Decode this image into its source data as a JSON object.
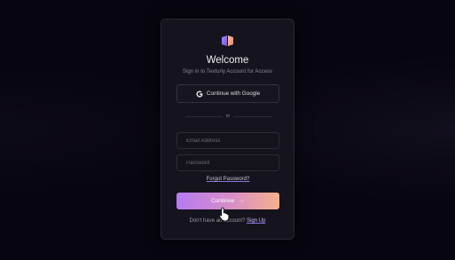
{
  "login": {
    "title": "Welcome",
    "subtitle": "Sign in to Texturly Account for Access",
    "google_button_label": "Continue with Google",
    "divider_text": "or",
    "email_placeholder": "Email Address",
    "email_value": "",
    "password_placeholder": "Password",
    "password_value": "",
    "forgot_password_label": "Forgot Password?",
    "continue_label": "Continue",
    "signup_prompt": "Don't have an account?",
    "signup_link_label": "Sign Up"
  },
  "icons": {
    "logo": "texturly-logo",
    "google": "google-g-icon",
    "arrow": "arrow-right-icon",
    "cursor": "hand-pointer-cursor"
  },
  "colors": {
    "background": "#07050f",
    "card": "#15131d",
    "accent_start": "#b77af2",
    "accent_end": "#f6b18a"
  }
}
